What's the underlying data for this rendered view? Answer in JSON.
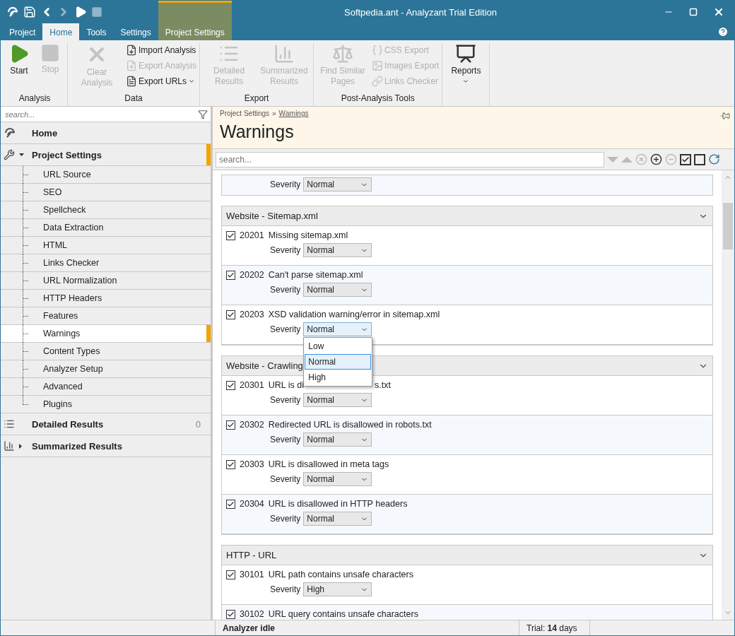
{
  "title_bar": {
    "title": "Softpedia.ant - Analyzant Trial Edition"
  },
  "ribbon_tabs": [
    {
      "label": "Project",
      "selected": false,
      "kind": "normal"
    },
    {
      "label": "Home",
      "selected": true,
      "kind": "normal"
    },
    {
      "label": "Tools",
      "selected": false,
      "kind": "normal"
    },
    {
      "label": "Settings",
      "selected": false,
      "kind": "normal"
    },
    {
      "label": "Project Settings",
      "selected": false,
      "kind": "contextual"
    }
  ],
  "ribbon_groups": [
    {
      "label": "Analysis",
      "items": [
        {
          "label": "Start",
          "kind": "large",
          "disabled": false
        },
        {
          "label": "Stop",
          "kind": "large",
          "disabled": true
        }
      ]
    },
    {
      "label": "Data",
      "items": [
        {
          "label": "Clear Analysis",
          "kind": "large",
          "disabled": true
        },
        {
          "label": "Import Analysis",
          "kind": "small",
          "disabled": false
        },
        {
          "label": "Export Analysis",
          "kind": "small",
          "disabled": true
        },
        {
          "label": "Export URLs",
          "kind": "small",
          "disabled": false,
          "dropdown": true
        }
      ]
    },
    {
      "label": "Export",
      "items": [
        {
          "label": "Detailed Results",
          "kind": "large",
          "disabled": true
        },
        {
          "label": "Summarized Results",
          "kind": "large",
          "disabled": true
        }
      ]
    },
    {
      "label": "Post-Analysis Tools",
      "items": [
        {
          "label": "Find Similar Pages",
          "kind": "large",
          "disabled": true
        },
        {
          "label": "CSS Export",
          "kind": "small",
          "disabled": true
        },
        {
          "label": "Images Export",
          "kind": "small",
          "disabled": true
        },
        {
          "label": "Links Checker",
          "kind": "small",
          "disabled": true
        }
      ]
    },
    {
      "items": [
        {
          "label": "Reports",
          "kind": "large",
          "disabled": false,
          "dropdown": true
        }
      ]
    }
  ],
  "sidebar": {
    "search_placeholder": "search...",
    "items": [
      {
        "label": "Home",
        "selected": false
      },
      {
        "label": "Project Settings",
        "selected": true,
        "expanded": true,
        "children": [
          {
            "label": "URL Source",
            "selected": false
          },
          {
            "label": "SEO",
            "selected": false
          },
          {
            "label": "Spellcheck",
            "selected": false
          },
          {
            "label": "Data Extraction",
            "selected": false
          },
          {
            "label": "HTML",
            "selected": false
          },
          {
            "label": "Links Checker",
            "selected": false
          },
          {
            "label": "URL Normalization",
            "selected": false
          },
          {
            "label": "HTTP Headers",
            "selected": false
          },
          {
            "label": "Features",
            "selected": false
          },
          {
            "label": "Warnings",
            "selected": true
          },
          {
            "label": "Content Types",
            "selected": false
          },
          {
            "label": "Analyzer Setup",
            "selected": false
          },
          {
            "label": "Advanced",
            "selected": false
          },
          {
            "label": "Plugins",
            "selected": false
          }
        ]
      },
      {
        "label": "Detailed Results",
        "selected": false,
        "badge": "0"
      },
      {
        "label": "Summarized Results",
        "selected": false,
        "expanded": false
      }
    ]
  },
  "breadcrumb": [
    {
      "label": "Project Settings",
      "link": false
    },
    {
      "label": "Warnings",
      "link": true
    }
  ],
  "breadcrumb_separator": "»",
  "page_title": "Warnings",
  "content_search_placeholder": "search...",
  "sections": [
    {
      "rows": [
        {
          "severity_label": "Severity",
          "severity": "Normal"
        }
      ]
    },
    {
      "title": "Website - Sitemap.xml",
      "rows": [
        {
          "checked": true,
          "code": "20201",
          "label": "Missing sitemap.xml",
          "severity_label": "Severity",
          "severity": "Normal"
        },
        {
          "checked": true,
          "code": "20202",
          "label": "Can't parse sitemap.xml",
          "severity_label": "Severity",
          "severity": "Normal"
        },
        {
          "checked": true,
          "code": "20203",
          "label": "XSD validation warning/error in sitemap.xml",
          "severity_label": "Severity",
          "severity": "Normal",
          "options": [
            {
              "label": "Low",
              "selected": false
            },
            {
              "label": "Normal",
              "selected": true
            },
            {
              "label": "High",
              "selected": false
            }
          ]
        }
      ]
    },
    {
      "title": "Website - Crawling",
      "rows": [
        {
          "checked": true,
          "code": "20301",
          "label": "URL is di",
          "label_tail": "s.txt",
          "severity_label": "Severity",
          "severity": "Normal"
        },
        {
          "checked": true,
          "code": "20302",
          "label": "Redirected URL is disallowed in robots.txt",
          "severity_label": "Severity",
          "severity": "Normal"
        },
        {
          "checked": true,
          "code": "20303",
          "label": "URL is disallowed in meta tags",
          "severity_label": "Severity",
          "severity": "Normal"
        },
        {
          "checked": true,
          "code": "20304",
          "label": "URL is disallowed in HTTP headers",
          "severity_label": "Severity",
          "severity": "Normal"
        }
      ]
    },
    {
      "title": "HTTP - URL",
      "rows": [
        {
          "checked": true,
          "code": "30101",
          "label": "URL path contains unsafe characters",
          "severity_label": "Severity",
          "severity": "High"
        },
        {
          "checked": true,
          "code": "30102",
          "label": "URL query contains unsafe characters"
        }
      ]
    }
  ],
  "status_bar": {
    "status": "Analyzer idle",
    "trial": "Trial: **14** days"
  }
}
